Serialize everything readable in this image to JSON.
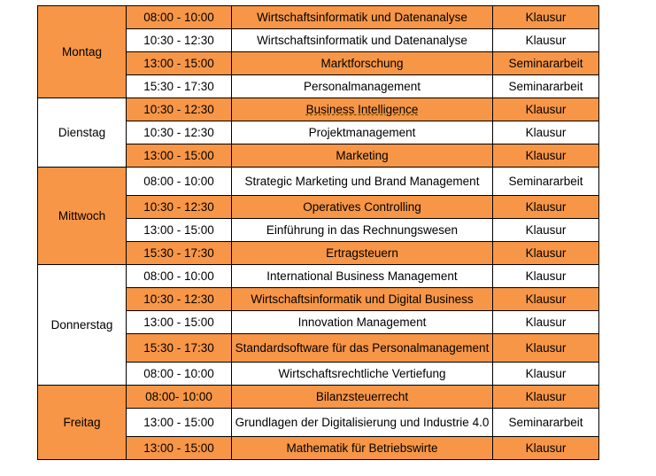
{
  "colors": {
    "highlight": "#f79646",
    "plain": "#ffffff",
    "border": "#000000"
  },
  "days": [
    {
      "day": "Montag",
      "highlight": true,
      "rows": [
        {
          "time": "08:00 - 10:00",
          "course": "Wirtschaftsinformatik und Datenanalyse",
          "type": "Klausur",
          "hl": true
        },
        {
          "time": "10:30 - 12:30",
          "course": "Wirtschaftsinformatik und Datenanalyse",
          "type": "Klausur",
          "hl": false
        },
        {
          "time": "13:00 - 15:00",
          "course": "Marktforschung",
          "type": "Seminararbeit",
          "hl": true
        },
        {
          "time": "15:30 - 17:30",
          "course": "Personalmanagement",
          "type": "Seminararbeit",
          "hl": false
        }
      ]
    },
    {
      "day": "Dienstag",
      "highlight": false,
      "rows": [
        {
          "time": "10:30 - 12:30",
          "course": "Business Intelligence",
          "type": "Klausur",
          "hl": true
        },
        {
          "time": "10:30 - 12:30",
          "course": "Projektmanagement",
          "type": "Klausur",
          "hl": false
        },
        {
          "time": "13:00 - 15:00",
          "course": "Marketing",
          "type": "Klausur",
          "hl": true
        }
      ]
    },
    {
      "day": "Mittwoch",
      "highlight": true,
      "rows": [
        {
          "time": "08:00 - 10:00",
          "course": "Strategic Marketing und Brand Management",
          "type": "Seminararbeit",
          "hl": false
        },
        {
          "time": "10:30 - 12:30",
          "course": "Operatives Controlling",
          "type": "Klausur",
          "hl": true
        },
        {
          "time": "13:00 - 15:00",
          "course": "Einführung in das Rechnungswesen",
          "type": "Klausur",
          "hl": false
        },
        {
          "time": "15:30 - 17:30",
          "course": "Ertragsteuern",
          "type": "Klausur",
          "hl": true
        }
      ]
    },
    {
      "day": "Donnerstag",
      "highlight": false,
      "rows": [
        {
          "time": "08:00 - 10:00",
          "course": "International Business Management",
          "type": "Klausur",
          "hl": false
        },
        {
          "time": "10:30 - 12:30",
          "course": "Wirtschaftsinformatik und Digital Business",
          "type": "Klausur",
          "hl": true
        },
        {
          "time": "13:00 - 15:00",
          "course": "Innovation Management",
          "type": "Klausur",
          "hl": false
        },
        {
          "time": "15:30 - 17:30",
          "course": "Standardsoftware für das Personalmanagement",
          "type": "Klausur",
          "hl": true
        },
        {
          "time": "08:00 - 10:00",
          "course": "Wirtschaftsrechtliche Vertiefung",
          "type": "Klausur",
          "hl": false
        }
      ]
    },
    {
      "day": "Freitag",
      "highlight": true,
      "rows": [
        {
          "time": "08:00- 10:00",
          "course": "Bilanzsteuerrecht",
          "type": "Klausur",
          "hl": true
        },
        {
          "time": "13:00 - 15:00",
          "course": "Grundlagen der Digitalisierung und Industrie 4.0",
          "type": "Seminararbeit",
          "hl": false
        },
        {
          "time": "13:00 - 15:00",
          "course": "Mathematik für Betriebswirte",
          "type": "Klausur",
          "hl": true
        }
      ]
    }
  ]
}
